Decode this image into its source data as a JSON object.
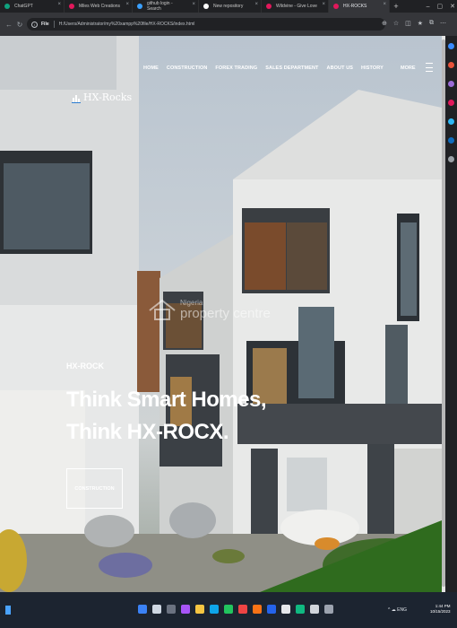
{
  "browser": {
    "tabs": [
      {
        "title": "ChatGPT",
        "color": "#10a37f"
      },
      {
        "title": "Miles Web Creations",
        "color": "#e2185b"
      },
      {
        "title": "github login - Search",
        "color": "#3aa0ff"
      },
      {
        "title": "New repository",
        "color": "#ffffff"
      },
      {
        "title": "Wildvine - Give Love for Saving",
        "color": "#e2185b"
      },
      {
        "title": "HX-ROCKS",
        "color": "#e2185b"
      }
    ],
    "new_tab": "+",
    "address": {
      "scheme": "File",
      "url": "H:/Users/Administrator/my%20xampp%20file/HX-ROCKS/index.html"
    }
  },
  "site": {
    "nav": [
      "HOME",
      "CONSTRUCTION",
      "FOREX TRADING",
      "SALES DEPARTMENT",
      "ABOUT US",
      "HISTORY"
    ],
    "more": "MORE",
    "logo": "HX-Rocks",
    "watermark": {
      "line1": "Nigeria",
      "line2": "property centre"
    },
    "hero": {
      "kicker": "HX-ROCK",
      "title_line1": "Think Smart Homes,",
      "title_line2": "Think HX-ROCX.",
      "cta": "CONSTRUCTION"
    }
  },
  "taskbar": {
    "tray": "^ ☁ ENG",
    "time": "1:44 PM",
    "date": "10/15/2023"
  }
}
